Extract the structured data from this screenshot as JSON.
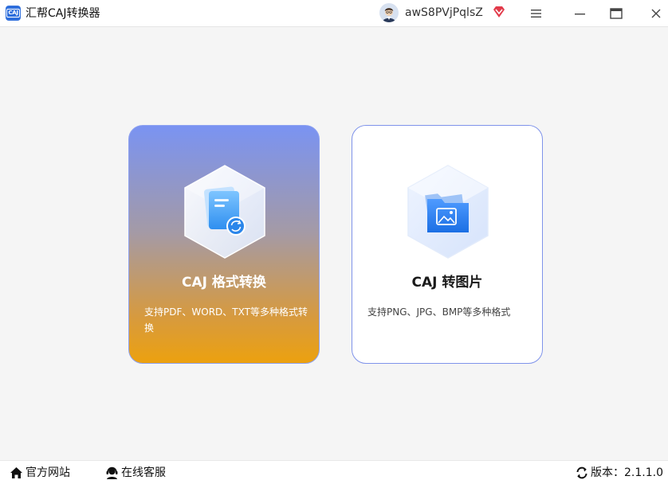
{
  "app": {
    "logo_text": "CAJ",
    "title": "汇帮CAJ转换器"
  },
  "user": {
    "name": "awS8PVjPqlsZ"
  },
  "cards": [
    {
      "title": "CAJ 格式转换",
      "description": "支持PDF、WORD、TXT等多种格式转换"
    },
    {
      "title": "CAJ 转图片",
      "description": "支持PNG、JPG、BMP等多种格式"
    }
  ],
  "footer": {
    "website": "官方网站",
    "support": "在线客服",
    "version_label": "版本：",
    "version": "2.1.1.0"
  },
  "colors": {
    "accent": "#2f6fdc",
    "card_gradient_top": "#7a93f2",
    "card_gradient_bottom": "#eca10f",
    "vip": "#e23a4a"
  },
  "icons": [
    "app-logo-icon",
    "avatar",
    "vip-diamond-icon",
    "menu-icon",
    "maximize-icon",
    "close-icon",
    "document-convert-icon",
    "image-folder-icon",
    "home-icon",
    "headset-icon",
    "refresh-icon"
  ]
}
